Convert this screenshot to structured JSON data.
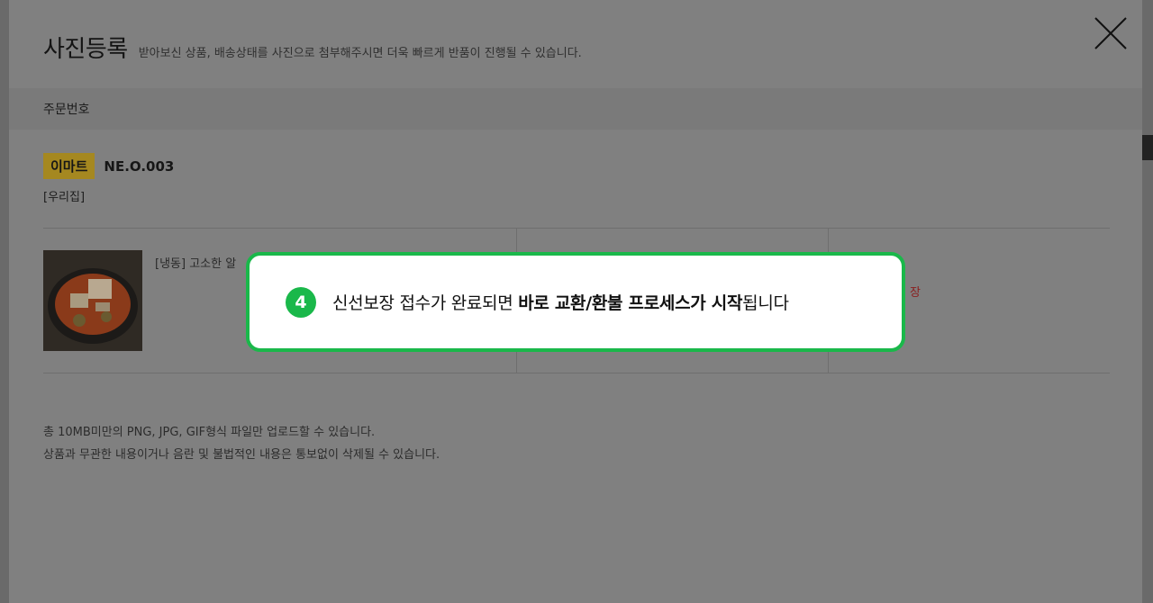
{
  "modal": {
    "title": "사진등록",
    "subtitle": "받아보신 상품, 배송상태를 사진으로 첨부해주시면 더욱 빠르게 반품이 진행될 수 있습니다.",
    "close_icon": "close-icon"
  },
  "order": {
    "header_label": "주문번호",
    "store_badge": "이마트",
    "order_number": "NE.O.003",
    "place": "[우리집]"
  },
  "product": {
    "name": "[냉동] 고소한 알",
    "status_mark": "장"
  },
  "notes": {
    "line1": "총 10MB미만의 PNG, JPG, GIF형식 파일만 업로드할 수 있습니다.",
    "line2": "상품과 무관한 내용이거나 음란 및 불법적인 내용은 통보없이 삭제될 수 있습니다."
  },
  "tooltip": {
    "step": "4",
    "text_prefix": "신선보장 접수가 완료되면 ",
    "text_bold": "바로 교환/환불 프로세스가 시작",
    "text_suffix": "됩니다"
  },
  "colors": {
    "accent_green": "#1ab84a",
    "store_badge": "#a58820"
  }
}
